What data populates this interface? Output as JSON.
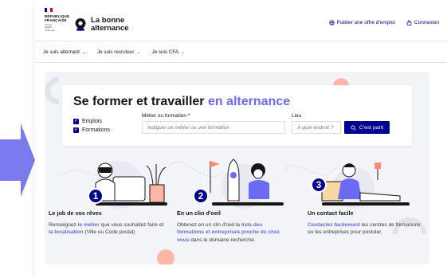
{
  "header": {
    "gov_lines": [
      "RÉPUBLIQUE",
      "FRANÇAISE"
    ],
    "gov_motto": [
      "Liberté",
      "Égalité",
      "Fraternité"
    ],
    "brand_line1": "La bonne",
    "brand_line2": "alternance",
    "publish_label": "Publier une offre d'emploi",
    "login_label": "Connexion"
  },
  "nav": {
    "items": [
      {
        "label": "Je suis alternant"
      },
      {
        "label": "Je suis recruteur"
      },
      {
        "label": "Je suis CFA"
      }
    ]
  },
  "search": {
    "title_part1": "Se former et travailler ",
    "title_accent": "en alternance",
    "checkbox_jobs": "Emplois",
    "checkbox_trainings": "Formations",
    "job_label": "Métier ou formation *",
    "job_placeholder": "Indiquer un métier ou une formation",
    "location_label": "Lieu",
    "location_placeholder": "À quel endroit ?",
    "button_label": "C'est parti"
  },
  "steps": [
    {
      "number": "1",
      "title": "Le job de vos rêves",
      "t1": "Renseignez ",
      "h1": "le métier",
      "t2": " que vous souhaitez faire et ",
      "h2": "la localisation",
      "t3": " (Ville ou Code postal)"
    },
    {
      "number": "2",
      "title": "En un clin d'oeil",
      "t1": "Obtenez en un clin d'oeil la ",
      "h1": "liste des formations et entreprises proche de chez vous",
      "t2": " dans le domaine recherché."
    },
    {
      "number": "3",
      "title": "Un contact facile",
      "h1": "Contactez facilement",
      "t1": " les centres de formations ou les entreprises pour postuler."
    }
  ],
  "colors": {
    "primary": "#000091",
    "accent": "#6a6af4",
    "hero_bg": "#f3f4f8",
    "arrow": "#7b7bef",
    "peach": "#ffb7a5"
  }
}
